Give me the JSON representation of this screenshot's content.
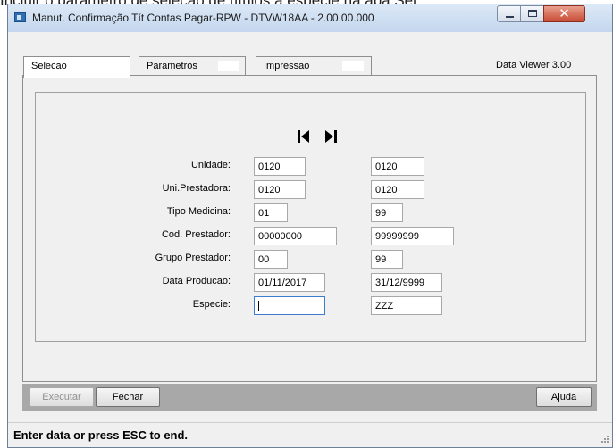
{
  "background_text": "Incluir o parâmetro de seleção de títulos a espécie na aba Sel",
  "window": {
    "title": "Manut. Confirmação Tít Contas Pagar-RPW - DTVW18AA - 2.00.00.000",
    "controls": {
      "minimize": "minimize-icon",
      "maximize": "maximize-icon",
      "close": "close-icon"
    }
  },
  "tabs": [
    {
      "label": "Selecao",
      "active": true
    },
    {
      "label": "Parametros",
      "active": false
    },
    {
      "label": "Impressao",
      "active": false
    }
  ],
  "viewer_label": "Data Viewer 3.00",
  "navigation": {
    "first": "first-record-icon",
    "last": "last-record-icon"
  },
  "form": {
    "rows": [
      {
        "label": "Unidade:",
        "from": "0120",
        "to": "0120"
      },
      {
        "label": "Uni.Prestadora:",
        "from": "0120",
        "to": "0120"
      },
      {
        "label": "Tipo Medicina:",
        "from": "01",
        "to": "99"
      },
      {
        "label": "Cod. Prestador:",
        "from": "00000000",
        "to": "99999999"
      },
      {
        "label": "Grupo Prestador:",
        "from": "00",
        "to": "99"
      },
      {
        "label": "Data Producao:",
        "from": "01/11/2017",
        "to": "31/12/9999"
      },
      {
        "label": "Especie:",
        "from": "",
        "to": "ZZZ"
      }
    ]
  },
  "buttons": {
    "execute": "Executar",
    "close": "Fechar",
    "help": "Ajuda"
  },
  "status": "Enter data or press ESC to end.",
  "colors": {
    "title_bg": "#c4d7ee",
    "close_button": "#c74a33",
    "footer_bar": "#a8a8a8",
    "focus_border": "#3d7bd1"
  }
}
